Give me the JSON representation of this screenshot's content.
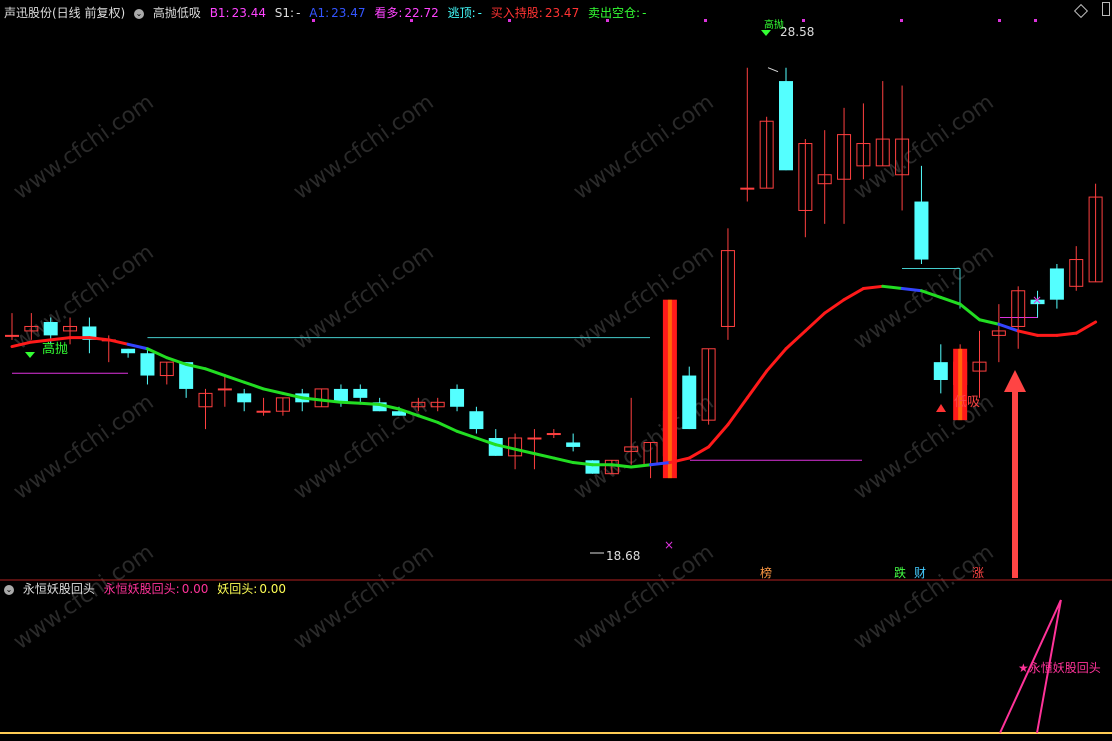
{
  "header_main": {
    "stock": "声迅股份(日线 前复权)",
    "indicator": "高抛低吸",
    "b1_label": "B1:",
    "b1_value": "23.44",
    "s1_label": "S1:",
    "s1_value": "-",
    "a1_label": "A1:",
    "a1_value": "23.47",
    "kanduo_label": "看多:",
    "kanduo_value": "22.72",
    "taoding_label": "逃顶:",
    "taoding_value": "-",
    "buy_label": "买入持股:",
    "buy_value": "23.47",
    "sell_label": "卖出空仓:",
    "sell_value": "-"
  },
  "header_sub": {
    "indicator": "永恒妖股回头",
    "line1_label": "永恒妖股回头:",
    "line1_value": "0.00",
    "line2_label": "妖回头:",
    "line2_value": "0.00"
  },
  "annotations": {
    "high_price": "28.58",
    "low_price": "18.68",
    "gaopao": "高抛",
    "dixi": "低吸",
    "top_marker": "高抛",
    "sub_marker": "★永恒妖股回头",
    "news_bang": "榜",
    "news_die": "跌",
    "news_cai": "财",
    "news_zhang": "涨",
    "watermark": "www.cfchi.com"
  },
  "colors": {
    "up": "#ff4040",
    "down": "#54ffff",
    "ma_rise": "#ff1a1a",
    "ma_fall": "#22dd22",
    "ma_flat": "#3344ff",
    "magenta": "#dd33dd",
    "pink": "#ff3399",
    "axis": "#b02020"
  },
  "chart_data": {
    "type": "candlestick",
    "ylim": [
      17.6,
      29.3
    ],
    "candles": [
      {
        "o": 22.5,
        "h": 23.0,
        "l": 22.4,
        "c": 22.5
      },
      {
        "o": 22.6,
        "h": 23.0,
        "l": 22.4,
        "c": 22.7
      },
      {
        "o": 22.8,
        "h": 22.9,
        "l": 22.3,
        "c": 22.5
      },
      {
        "o": 22.6,
        "h": 22.9,
        "l": 22.3,
        "c": 22.7
      },
      {
        "o": 22.7,
        "h": 22.9,
        "l": 22.1,
        "c": 22.4
      },
      {
        "o": 22.4,
        "h": 22.5,
        "l": 21.9,
        "c": 22.4
      },
      {
        "o": 22.2,
        "h": 22.2,
        "l": 22.0,
        "c": 22.1
      },
      {
        "o": 22.1,
        "h": 22.2,
        "l": 21.4,
        "c": 21.6
      },
      {
        "o": 21.6,
        "h": 21.9,
        "l": 21.4,
        "c": 21.9
      },
      {
        "o": 21.9,
        "h": 21.9,
        "l": 21.1,
        "c": 21.3
      },
      {
        "o": 20.9,
        "h": 21.3,
        "l": 20.4,
        "c": 21.2
      },
      {
        "o": 21.3,
        "h": 21.6,
        "l": 20.9,
        "c": 21.3
      },
      {
        "o": 21.2,
        "h": 21.3,
        "l": 20.8,
        "c": 21.0
      },
      {
        "o": 20.8,
        "h": 21.1,
        "l": 20.7,
        "c": 20.8
      },
      {
        "o": 20.8,
        "h": 21.1,
        "l": 20.7,
        "c": 21.1
      },
      {
        "o": 21.2,
        "h": 21.3,
        "l": 20.8,
        "c": 21.0
      },
      {
        "o": 20.9,
        "h": 21.3,
        "l": 20.9,
        "c": 21.3
      },
      {
        "o": 21.3,
        "h": 21.4,
        "l": 20.9,
        "c": 21.0
      },
      {
        "o": 21.3,
        "h": 21.4,
        "l": 21.0,
        "c": 21.1
      },
      {
        "o": 21.0,
        "h": 21.1,
        "l": 20.8,
        "c": 20.8
      },
      {
        "o": 20.8,
        "h": 20.9,
        "l": 20.7,
        "c": 20.7
      },
      {
        "o": 20.9,
        "h": 21.1,
        "l": 20.8,
        "c": 21.0
      },
      {
        "o": 20.9,
        "h": 21.1,
        "l": 20.8,
        "c": 21.0
      },
      {
        "o": 21.3,
        "h": 21.4,
        "l": 20.8,
        "c": 20.9
      },
      {
        "o": 20.8,
        "h": 20.9,
        "l": 20.3,
        "c": 20.4
      },
      {
        "o": 20.2,
        "h": 20.4,
        "l": 19.8,
        "c": 19.8
      },
      {
        "o": 19.8,
        "h": 20.3,
        "l": 19.5,
        "c": 20.2
      },
      {
        "o": 20.2,
        "h": 20.4,
        "l": 19.5,
        "c": 20.2
      },
      {
        "o": 20.3,
        "h": 20.4,
        "l": 20.2,
        "c": 20.3
      },
      {
        "o": 20.1,
        "h": 20.3,
        "l": 19.9,
        "c": 20.0
      },
      {
        "o": 19.7,
        "h": 19.7,
        "l": 19.4,
        "c": 19.4
      },
      {
        "o": 19.4,
        "h": 19.7,
        "l": 19.4,
        "c": 19.7
      },
      {
        "o": 19.9,
        "h": 21.1,
        "l": 19.6,
        "c": 20.0
      },
      {
        "o": 19.6,
        "h": 20.1,
        "l": 19.3,
        "c": 20.1
      },
      {
        "o": 19.8,
        "h": 20.8,
        "l": 19.6,
        "c": 20.8
      },
      {
        "o": 21.6,
        "h": 21.8,
        "l": 20.4,
        "c": 20.4
      },
      {
        "o": 20.6,
        "h": 22.2,
        "l": 20.5,
        "c": 22.2
      },
      {
        "o": 22.7,
        "h": 24.9,
        "l": 22.4,
        "c": 24.4
      },
      {
        "o": 25.8,
        "h": 28.5,
        "l": 25.5,
        "c": 25.8
      },
      {
        "o": 25.8,
        "h": 27.4,
        "l": 25.8,
        "c": 27.3
      },
      {
        "o": 28.2,
        "h": 28.5,
        "l": 26.2,
        "c": 26.2
      },
      {
        "o": 25.3,
        "h": 26.9,
        "l": 24.7,
        "c": 26.8
      },
      {
        "o": 25.9,
        "h": 27.1,
        "l": 25.0,
        "c": 26.1
      },
      {
        "o": 26.0,
        "h": 27.6,
        "l": 25.0,
        "c": 27.0
      },
      {
        "o": 26.3,
        "h": 27.7,
        "l": 26.0,
        "c": 26.8
      },
      {
        "o": 26.3,
        "h": 28.2,
        "l": 26.3,
        "c": 26.9
      },
      {
        "o": 26.1,
        "h": 28.1,
        "l": 25.3,
        "c": 26.9
      },
      {
        "o": 25.5,
        "h": 26.3,
        "l": 24.1,
        "c": 24.2
      },
      {
        "o": 21.9,
        "h": 22.3,
        "l": 21.2,
        "c": 21.5
      },
      {
        "o": 21.4,
        "h": 22.3,
        "l": 21.2,
        "c": 21.9
      },
      {
        "o": 21.7,
        "h": 22.6,
        "l": 21.1,
        "c": 21.9
      },
      {
        "o": 22.5,
        "h": 23.2,
        "l": 21.9,
        "c": 22.6
      },
      {
        "o": 22.7,
        "h": 23.6,
        "l": 22.2,
        "c": 23.5
      },
      {
        "o": 23.3,
        "h": 23.5,
        "l": 22.9,
        "c": 23.2
      },
      {
        "o": 24.0,
        "h": 24.1,
        "l": 23.1,
        "c": 23.3
      },
      {
        "o": 23.6,
        "h": 24.5,
        "l": 23.5,
        "c": 24.2
      },
      {
        "o": 23.7,
        "h": 25.9,
        "l": 23.7,
        "c": 25.6
      }
    ],
    "ma_line": [
      22.25,
      22.35,
      22.4,
      22.45,
      22.45,
      22.4,
      22.3,
      22.2,
      22.0,
      21.85,
      21.75,
      21.6,
      21.45,
      21.3,
      21.2,
      21.1,
      21.05,
      21.0,
      20.98,
      20.95,
      20.85,
      20.7,
      20.55,
      20.35,
      20.2,
      20.05,
      19.95,
      19.85,
      19.75,
      19.65,
      19.6,
      19.6,
      19.55,
      19.6,
      19.65,
      19.75,
      20.0,
      20.5,
      21.1,
      21.7,
      22.2,
      22.6,
      23.0,
      23.3,
      23.55,
      23.6,
      23.55,
      23.5,
      23.35,
      23.2,
      22.85,
      22.75,
      22.6,
      22.5,
      22.5,
      22.55,
      22.8
    ],
    "sub_indicator": {
      "values_shown": [
        "0.00",
        "0.00"
      ],
      "spike_index": 54
    }
  }
}
